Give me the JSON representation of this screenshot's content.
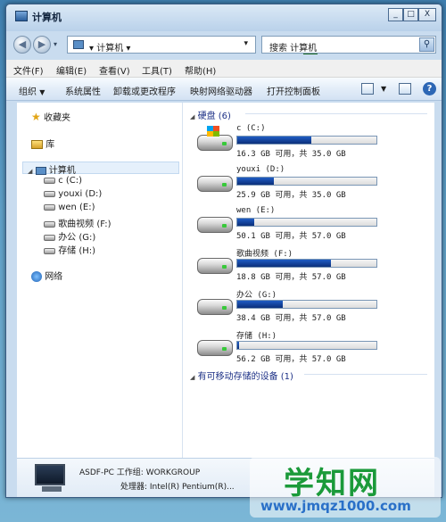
{
  "window": {
    "title": "计算机"
  },
  "controls": {
    "minimize": "_",
    "maximize": "□",
    "close": "X"
  },
  "navbar": {
    "address_crumb": "▾ 计算机 ▾",
    "search_placeholder": "搜索 计算机"
  },
  "menu": [
    "文件(F)",
    "编辑(E)",
    "查看(V)",
    "工具(T)",
    "帮助(H)"
  ],
  "commands": {
    "organize": "组织",
    "system_props": "系统属性",
    "uninstall": "卸载或更改程序",
    "map_drive": "映射网络驱动器",
    "control_panel": "打开控制面板"
  },
  "sidebar": {
    "favorites": "收藏夹",
    "libraries": "库",
    "computer": "计算机",
    "drives": [
      "c (C:)",
      "youxi (D:)",
      "wen (E:)",
      "歌曲视频 (F:)",
      "办公 (G:)",
      "存储 (H:)"
    ],
    "network": "网络"
  },
  "content": {
    "hdd_group": "硬盘 (6)",
    "removable_group": "有可移动存储的设备 (1)",
    "drives": [
      {
        "name": "c (C:)",
        "info": "16.3 GB 可用，共 35.0 GB",
        "used_fraction": 0.53,
        "system": true
      },
      {
        "name": "youxi (D:)",
        "info": "25.9 GB 可用，共 35.0 GB",
        "used_fraction": 0.26,
        "system": false
      },
      {
        "name": "wen (E:)",
        "info": "50.1 GB 可用，共 57.0 GB",
        "used_fraction": 0.12,
        "system": false
      },
      {
        "name": "歌曲视频 (F:)",
        "info": "18.8 GB 可用，共 57.0 GB",
        "used_fraction": 0.67,
        "system": false
      },
      {
        "name": "办公 (G:)",
        "info": "38.4 GB 可用，共 57.0 GB",
        "used_fraction": 0.33,
        "system": false
      },
      {
        "name": "存储 (H:)",
        "info": "56.2 GB 可用，共 57.0 GB",
        "used_fraction": 0.01,
        "system": false
      }
    ]
  },
  "details": {
    "name_line": "ASDF-PC 工作组: WORKGROUP",
    "cpu_line": "处理器: Intel(R) Pentium(R)..."
  },
  "watermark": {
    "title": "学知网",
    "url": "www.jmqz1000.com"
  },
  "colors": {
    "bar": "#0b2f7a",
    "group_header": "#1e3287"
  }
}
